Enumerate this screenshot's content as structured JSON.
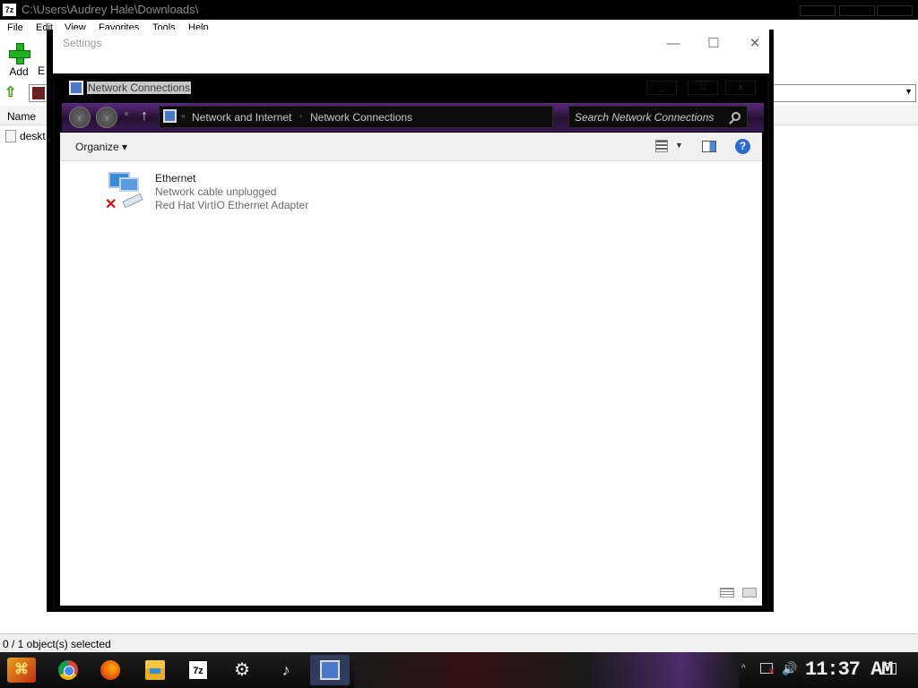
{
  "zip": {
    "title": "C:\\Users\\Audrey Hale\\Downloads\\",
    "app_icon": "7z",
    "menu": [
      "File",
      "Edit",
      "View",
      "Favorites",
      "Tools",
      "Help"
    ],
    "toolbar": {
      "add_label": "Add",
      "extract_partial": "E"
    },
    "header_name": "Name",
    "file_partial": "deskt",
    "status": "0 / 1 object(s) selected",
    "icons": {
      "add": "plus-icon",
      "up": "up-arrow-icon"
    }
  },
  "settings": {
    "title": "Settings",
    "controls": {
      "minimize": "—",
      "maximize": "☐",
      "close": "✕"
    }
  },
  "netconn": {
    "title": "Network Connections",
    "controls": {
      "minimize": "_",
      "maximize": "□",
      "close": "x"
    },
    "breadcrumb": {
      "sep1": "«",
      "part1": "Network and Internet",
      "sep2": "›",
      "part2": "Network Connections"
    },
    "search_placeholder": "Search Network Connections",
    "organize_label": "Organize ▾",
    "help_label": "?",
    "items": [
      {
        "name": "Ethernet",
        "status": "Network cable unplugged",
        "device": "Red Hat VirtIO Ethernet Adapter"
      }
    ]
  },
  "taskbar": {
    "start_glyph": "⌘",
    "apps": [
      "chrome",
      "firefox",
      "file-explorer",
      "7-zip",
      "settings",
      "app",
      "network-connections"
    ],
    "seven_zip_label": "7z",
    "settings_glyph": "⚙",
    "app6_glyph": "♪",
    "tray_up": "^",
    "volume_glyph": "🔊",
    "clock": "11:37 AM"
  },
  "colors": {
    "accent_purple": "#5a2a80",
    "help_blue": "#2a6cd0",
    "error_red": "#d01010"
  }
}
